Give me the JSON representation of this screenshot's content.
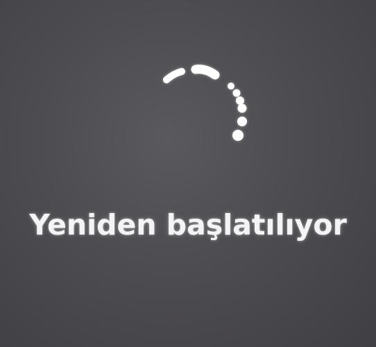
{
  "restart_screen": {
    "status_text": "Yeniden başlatılıyor",
    "spinner_icon": "loading-spinner-icon",
    "colors": {
      "background": "#4d4c50",
      "foreground": "#f4f4f6"
    }
  }
}
